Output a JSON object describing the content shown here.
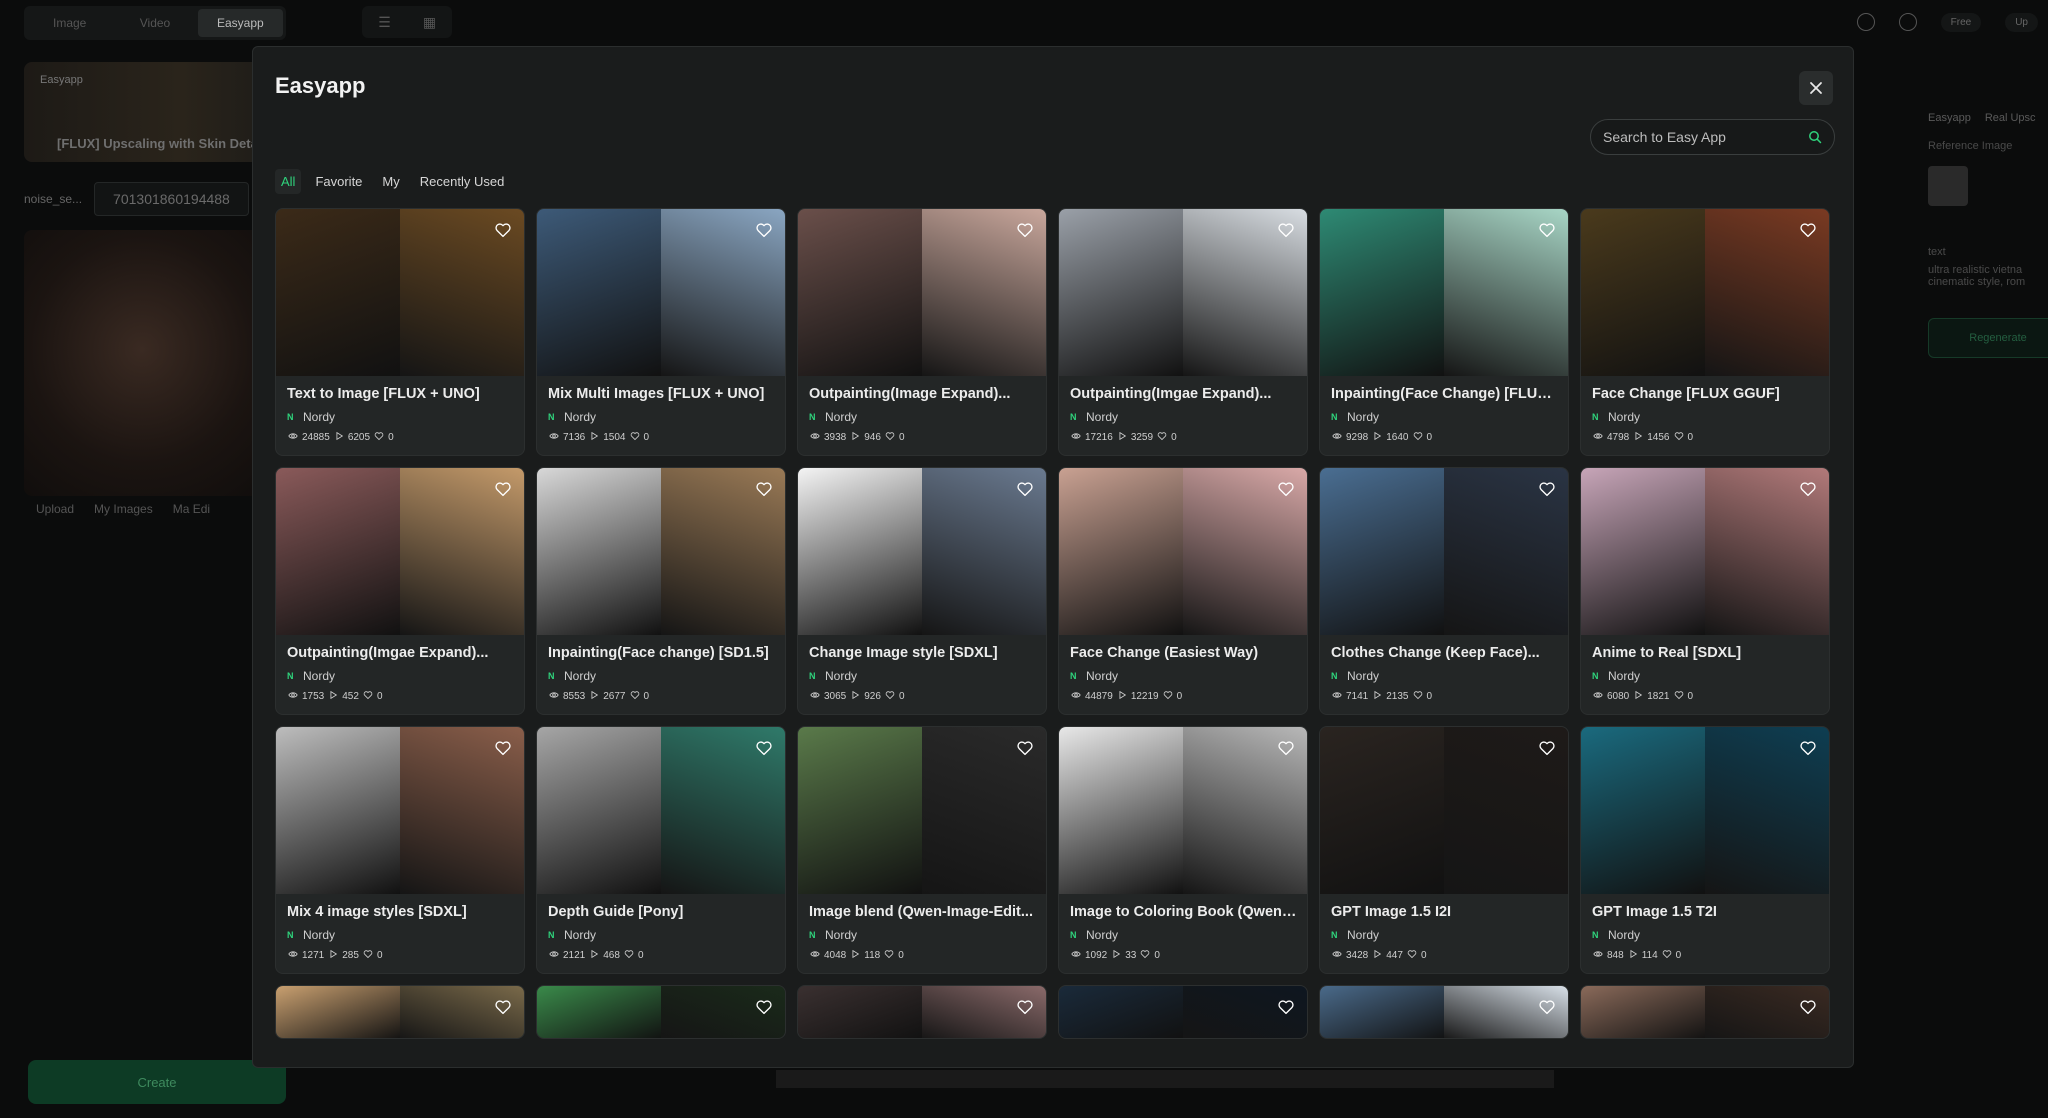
{
  "background": {
    "tabs": [
      "Image",
      "Video",
      "Easyapp"
    ],
    "active_tab": "Easyapp",
    "plan": "Free",
    "upgrade": "Up",
    "card_label": "Easyapp",
    "card_title": "[FLUX] Upscaling with Skin Detail",
    "seed_key": "noise_se...",
    "seed_value": "701301860194488",
    "upload": "Upload",
    "my_images": "My Images",
    "make_edit": "Ma Edi",
    "create": "Create",
    "right_tabs": [
      "Easyapp",
      "Real Upsc"
    ],
    "reference_image": "Reference Image",
    "text_label": "text",
    "prompt_preview": "ultra realistic vietna cinematic style, rom",
    "regenerate": "Regenerate"
  },
  "modal": {
    "title": "Easyapp",
    "search_placeholder": "Search to Easy App",
    "filters": [
      "All",
      "Favorite",
      "My",
      "Recently Used"
    ],
    "active_filter": "All",
    "accent": "#2fd37c",
    "apps": [
      {
        "title": "Text to Image [FLUX + UNO]",
        "author": "Nordy",
        "views": "24885",
        "runs": "6205",
        "likes": "0",
        "colors": [
          "#3b2a18",
          "#6b4a22"
        ]
      },
      {
        "title": "Mix Multi Images [FLUX + UNO]",
        "author": "Nordy",
        "views": "7136",
        "runs": "1504",
        "likes": "0",
        "colors": [
          "#3d5a78",
          "#8aa6c2"
        ]
      },
      {
        "title": "Outpainting(Image Expand)...",
        "author": "Nordy",
        "views": "3938",
        "runs": "946",
        "likes": "0",
        "colors": [
          "#6a4f4a",
          "#c9a79c"
        ]
      },
      {
        "title": "Outpainting(Imgae Expand)...",
        "author": "Nordy",
        "views": "17216",
        "runs": "3259",
        "likes": "0",
        "colors": [
          "#9aa0a8",
          "#d8dde2"
        ]
      },
      {
        "title": "Inpainting(Face Change) [FLUX...",
        "author": "Nordy",
        "views": "9298",
        "runs": "1640",
        "likes": "0",
        "colors": [
          "#2e8a74",
          "#a8d6c6"
        ]
      },
      {
        "title": "Face Change [FLUX GGUF]",
        "author": "Nordy",
        "views": "4798",
        "runs": "1456",
        "likes": "0",
        "colors": [
          "#4a3a1c",
          "#7a3a22"
        ]
      },
      {
        "title": "Outpainting(Imgae Expand)...",
        "author": "Nordy",
        "views": "1753",
        "runs": "452",
        "likes": "0",
        "colors": [
          "#8a5a5a",
          "#c49a6a"
        ]
      },
      {
        "title": "Inpainting(Face change) [SD1.5]",
        "author": "Nordy",
        "views": "8553",
        "runs": "2677",
        "likes": "0",
        "colors": [
          "#d8d8d8",
          "#9a7a56"
        ]
      },
      {
        "title": "Change Image style [SDXL]",
        "author": "Nordy",
        "views": "3065",
        "runs": "926",
        "likes": "0",
        "colors": [
          "#f4f4f4",
          "#6a7a90"
        ]
      },
      {
        "title": "Face Change (Easiest Way)",
        "author": "Nordy",
        "views": "44879",
        "runs": "12219",
        "likes": "0",
        "colors": [
          "#c9a192",
          "#d9a9a8"
        ]
      },
      {
        "title": "Clothes Change (Keep Face)...",
        "author": "Nordy",
        "views": "7141",
        "runs": "2135",
        "likes": "0",
        "colors": [
          "#4a6e92",
          "#2a3444"
        ]
      },
      {
        "title": "Anime to Real [SDXL]",
        "author": "Nordy",
        "views": "6080",
        "runs": "1821",
        "likes": "0",
        "colors": [
          "#c7a5b8",
          "#b27a7a"
        ]
      },
      {
        "title": "Mix 4 image styles [SDXL]",
        "author": "Nordy",
        "views": "1271",
        "runs": "285",
        "likes": "0",
        "colors": [
          "#bdbdbd",
          "#8a5e4a"
        ]
      },
      {
        "title": "Depth Guide [Pony]",
        "author": "Nordy",
        "views": "2121",
        "runs": "468",
        "likes": "0",
        "colors": [
          "#a6a6a6",
          "#2f7a6a"
        ]
      },
      {
        "title": "Image blend (Qwen-Image-Edit...",
        "author": "Nordy",
        "views": "4048",
        "runs": "118",
        "likes": "0",
        "colors": [
          "#5a7a4a",
          "#2a2a2a"
        ]
      },
      {
        "title": "Image to Coloring Book (Qwen-...",
        "author": "Nordy",
        "views": "1092",
        "runs": "33",
        "likes": "0",
        "colors": [
          "#e8e8e8",
          "#b8b8b8"
        ]
      },
      {
        "title": "GPT Image 1.5 I2I",
        "author": "Nordy",
        "views": "3428",
        "runs": "447",
        "likes": "0",
        "colors": [
          "#2a2420",
          "#1e1a18"
        ]
      },
      {
        "title": "GPT Image 1.5 T2I",
        "author": "Nordy",
        "views": "848",
        "runs": "114",
        "likes": "0",
        "colors": [
          "#1a6a7e",
          "#0e3e52"
        ]
      }
    ],
    "partial_rows": [
      {
        "colors": [
          "#c9a070",
          "#7a6a4a"
        ]
      },
      {
        "colors": [
          "#3a8a4a",
          "#1a2a1a"
        ]
      },
      {
        "colors": [
          "#3a3030",
          "#8a6a6a"
        ]
      },
      {
        "colors": [
          "#1a2a3a",
          "#0e1620"
        ]
      },
      {
        "colors": [
          "#4a6a8a",
          "#d8e0e8"
        ]
      },
      {
        "colors": [
          "#8a6a5a",
          "#3a2a22"
        ]
      }
    ]
  }
}
